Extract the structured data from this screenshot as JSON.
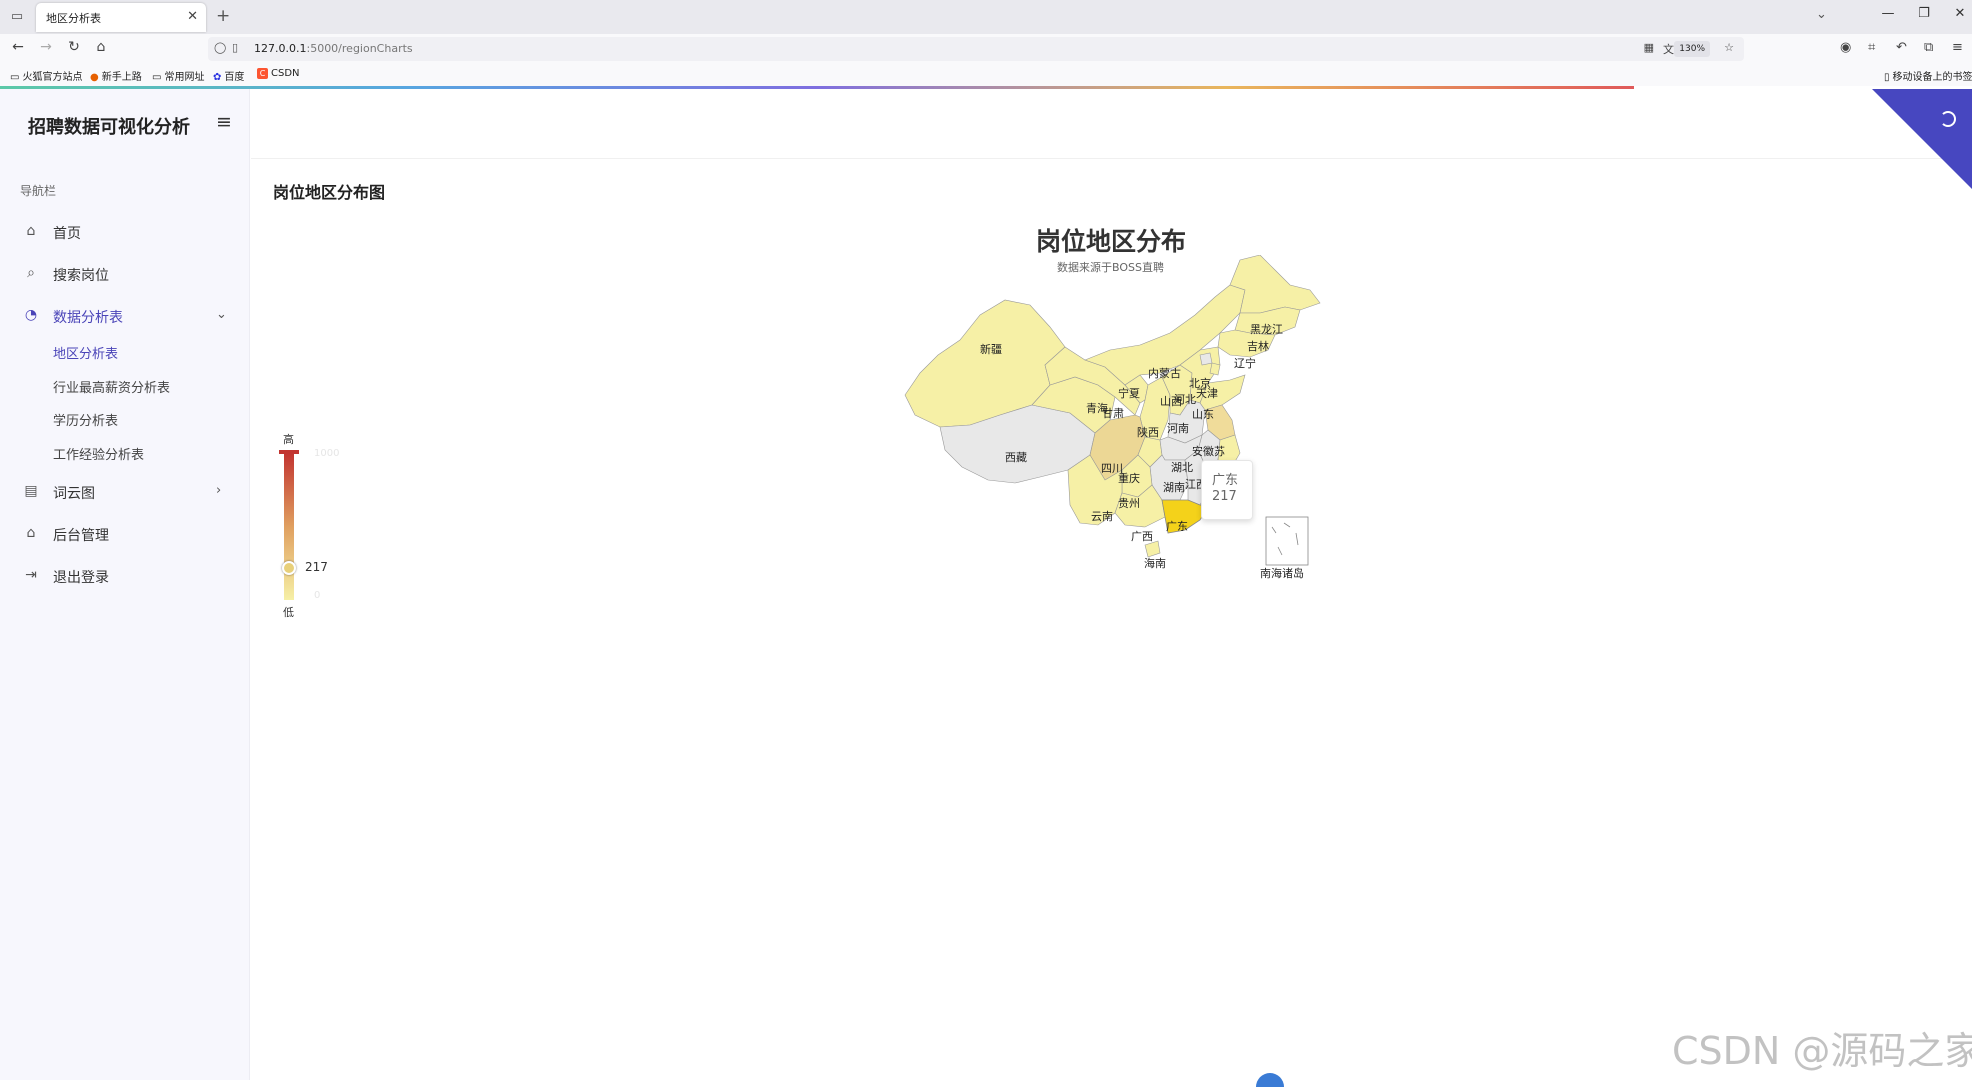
{
  "browser": {
    "tab_title": "地区分析表",
    "url_host": "127.0.0.1",
    "url_path": ":5000/regionCharts",
    "zoom": "130%",
    "bookmarks": [
      "火狐官方站点",
      "新手上路",
      "常用网址",
      "百度",
      "CSDN"
    ],
    "mobile_bookmarks": "移动设备上的书签"
  },
  "sidebar": {
    "brand": "招聘数据可视化分析",
    "nav_caption": "导航栏",
    "items": [
      {
        "label": "首页",
        "icon": "home-icon"
      },
      {
        "label": "搜索岗位",
        "icon": "search-icon"
      },
      {
        "label": "数据分析表",
        "icon": "pie-chart-icon"
      },
      {
        "label": "词云图",
        "icon": "document-icon"
      },
      {
        "label": "后台管理",
        "icon": "home-icon"
      },
      {
        "label": "退出登录",
        "icon": "logout-icon"
      }
    ],
    "sub_items": [
      "地区分析表",
      "行业最高薪资分析表",
      "学历分析表",
      "工作经验分析表"
    ]
  },
  "page": {
    "card_title": "岗位地区分布图"
  },
  "chart_data": {
    "type": "map",
    "title": "岗位地区分布",
    "subtitle": "数据来源于BOSS直聘",
    "visual_map": {
      "min": 0,
      "max": 1000,
      "high_label": "高",
      "low_label": "低",
      "current": 217
    },
    "tooltip": {
      "name": "广东",
      "value": 217
    },
    "regions": [
      "新疆",
      "西藏",
      "青海",
      "甘肃",
      "宁夏",
      "内蒙古",
      "黑龙江",
      "吉林",
      "辽宁",
      "北京",
      "天津",
      "河北",
      "山西",
      "山东",
      "陕西",
      "河南",
      "四川",
      "重庆",
      "湖北",
      "湖南",
      "贵州",
      "云南",
      "广西",
      "广东",
      "海南",
      "江西",
      "安徽",
      "江苏",
      "南海诸岛"
    ],
    "highlight": {
      "region": "广东",
      "value": 217
    },
    "colors": {
      "high": "#c23531",
      "mid": "#e8d07a",
      "low": "#f6f0a6",
      "none": "#e8e8e8",
      "highlight": "#f4d21a"
    }
  },
  "watermark": "CSDN @源码之家"
}
